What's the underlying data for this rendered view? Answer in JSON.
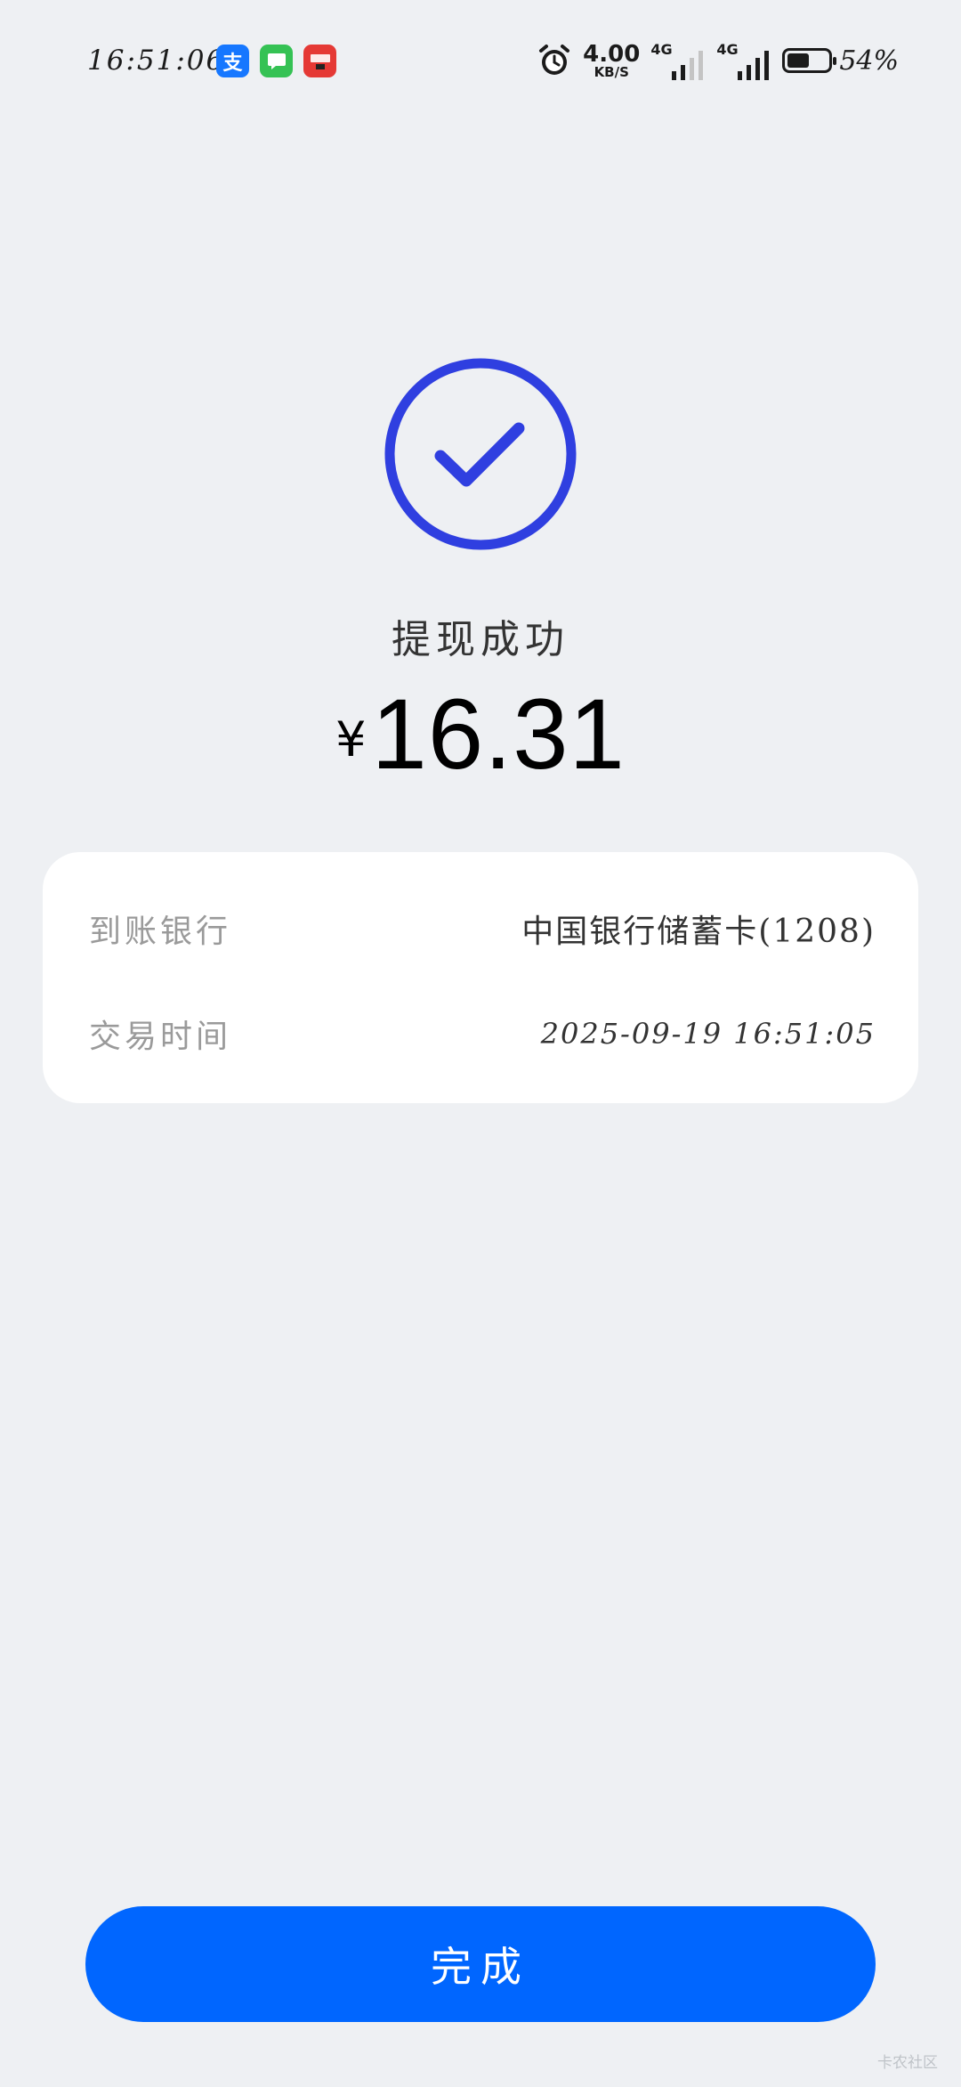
{
  "status_bar": {
    "time": "16:51:06",
    "notification_icons": [
      "alipay-icon",
      "messages-icon",
      "wallet-icon"
    ],
    "net_speed_value": "4.00",
    "net_speed_unit": "KB/S",
    "sim1_network": "4G",
    "sim2_network": "4G",
    "battery_percent": "54%",
    "battery_level": 0.54
  },
  "result": {
    "title": "提现成功",
    "currency_symbol": "¥",
    "amount": "16.31",
    "accent_color": "#2f3fe0"
  },
  "details": {
    "bank_label": "到账银行",
    "bank_value": "中国银行储蓄卡(1208)",
    "time_label": "交易时间",
    "time_value": "2025-09-19  16:51:05"
  },
  "actions": {
    "done_label": "完成",
    "button_color": "#0066ff"
  },
  "watermark": "卡农社区"
}
